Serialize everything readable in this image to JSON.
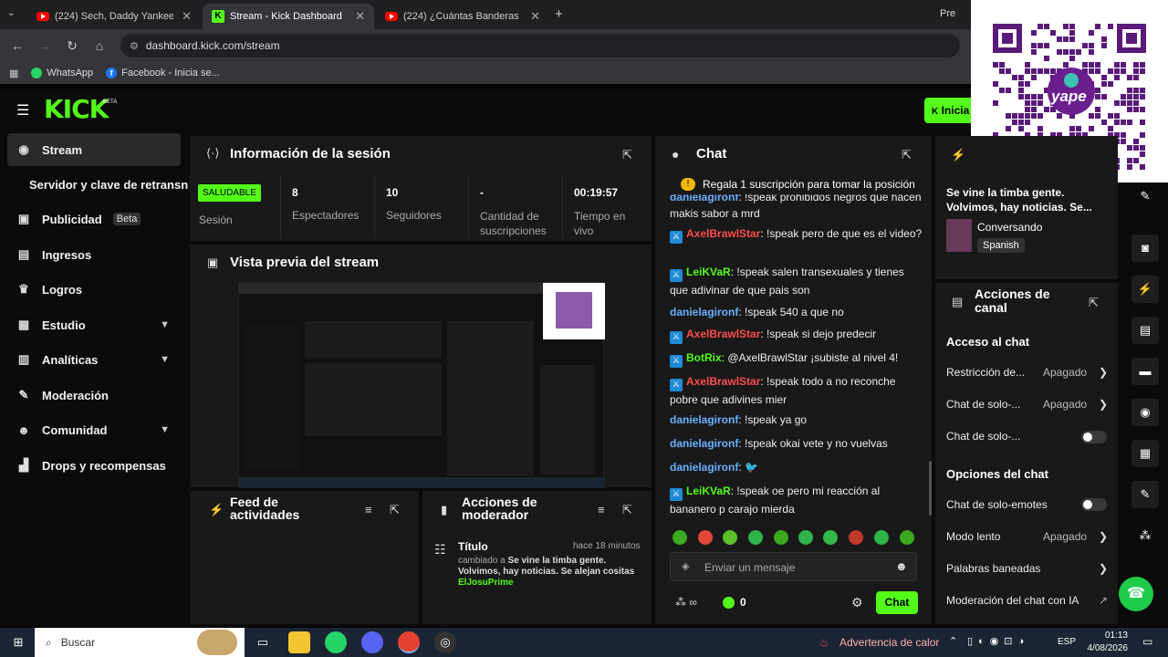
{
  "browser": {
    "tabs": [
      {
        "label": "(224) Sech, Daddy Yankee, J Bal"
      },
      {
        "label": "Stream - Kick Dashboard"
      },
      {
        "label": "(224) ¿Cuántas Banderas Conoc"
      }
    ],
    "new_tab": "+",
    "right_tab": "Pre",
    "url": "dashboard.kick.com/stream",
    "bookmarks": [
      {
        "label": "WhatsApp"
      },
      {
        "label": "Facebook - Inicia se..."
      }
    ]
  },
  "topnav": {
    "logo": "KICK",
    "beta": "BETA",
    "start_button": "Inicia"
  },
  "qr": {
    "brand": "yape"
  },
  "sidebar": {
    "items": [
      {
        "label": "Stream"
      },
      {
        "label": "Servidor y clave de retransn"
      },
      {
        "label": "Publicidad",
        "badge": "Beta"
      },
      {
        "label": "Ingresos"
      },
      {
        "label": "Logros"
      },
      {
        "label": "Estudio"
      },
      {
        "label": "Analíticas"
      },
      {
        "label": "Moderación"
      },
      {
        "label": "Comunidad"
      },
      {
        "label": "Drops y recompensas"
      }
    ]
  },
  "session": {
    "title": "Información de la sesión",
    "status_badge": "SALUDABLE",
    "status_label": "Sesión",
    "stats": [
      {
        "value": "8",
        "label": "Espectadores"
      },
      {
        "value": "10",
        "label": "Seguidores"
      },
      {
        "value": "-",
        "label": "Cantidad de suscripciones"
      },
      {
        "value": "00:19:57",
        "label": "Tiempo en vivo"
      }
    ]
  },
  "preview": {
    "title": "Vista previa del stream"
  },
  "activity": {
    "title": "Feed de actividades"
  },
  "modactions": {
    "title": "Acciones de moderador",
    "entry": {
      "heading": "Título",
      "time": "hace 18 minutos",
      "prefix": "cambiado a",
      "text": "Se vine la timba gente. Volvimos, hay noticias. Se alejan cositas",
      "user": "ElJosuPrime"
    }
  },
  "chat": {
    "title": "Chat",
    "pinned": "Regala 1 suscripción para tomar la posición",
    "messages": [
      {
        "user": "danielagironf",
        "color": "blue",
        "mod": false,
        "text": "!speak prohibidos negros que hacen makis sabor a mrd"
      },
      {
        "user": "AxelBrawlStar",
        "color": "red",
        "mod": true,
        "text": "!speak pero de que es el video?"
      },
      {
        "user": "LeiKVaR",
        "color": "green",
        "mod": true,
        "text": "!speak salen transexuales y tienes que adivinar de que pais son"
      },
      {
        "user": "danielagironf",
        "color": "blue",
        "mod": false,
        "text": "!speak 540 a que no"
      },
      {
        "user": "AxelBrawlStar",
        "color": "red",
        "mod": true,
        "text": "!speak si dejo predecir"
      },
      {
        "user": "BotRix",
        "color": "green",
        "mod": true,
        "text": "@AxelBrawlStar ¡subiste al nivel 4!"
      },
      {
        "user": "AxelBrawlStar",
        "color": "red",
        "mod": true,
        "text": "!speak todo a no reconche pobre que adivines mier"
      },
      {
        "user": "danielagironf",
        "color": "blue",
        "mod": false,
        "text": "!speak ya go"
      },
      {
        "user": "danielagironf",
        "color": "blue",
        "mod": false,
        "text": "!speak okai vete y no vuelvas"
      },
      {
        "user": "danielagironf",
        "color": "blue",
        "mod": false,
        "text": "🐦"
      },
      {
        "user": "LeiKVaR",
        "color": "green",
        "mod": true,
        "text": "!speak oe pero mi reacción al bananero p carajo mierda"
      }
    ],
    "input_placeholder": "Enviar un mensaje",
    "points_symbol": "∞",
    "points_value": "0",
    "send_label": "Chat"
  },
  "stream_info": {
    "title": "Se vine la timba gente. Volvimos, hay noticias. Se...",
    "category": "Conversando",
    "language": "Spanish"
  },
  "channel_actions": {
    "title": "Acciones de canal",
    "sections": [
      {
        "heading": "Acceso al chat"
      },
      {
        "heading": "Opciones del chat"
      }
    ],
    "rows": [
      {
        "label": "Restricción de...",
        "value": "Apagado"
      },
      {
        "label": "Chat de solo-...",
        "value": "Apagado"
      },
      {
        "label": "Chat de solo-..."
      },
      {
        "label": "Chat de solo-emotes"
      },
      {
        "label": "Modo lento",
        "value": "Apagado"
      },
      {
        "label": "Palabras baneadas"
      },
      {
        "label": "Moderación del chat con IA"
      }
    ]
  },
  "taskbar": {
    "search": "Buscar",
    "warning": "Advertencia de calor",
    "lang": "ESP",
    "time": "01:13",
    "date": "4/08/2026"
  },
  "colors": {
    "accent": "#53fc18",
    "panel": "#191919",
    "bg": "#0b0b0b"
  }
}
